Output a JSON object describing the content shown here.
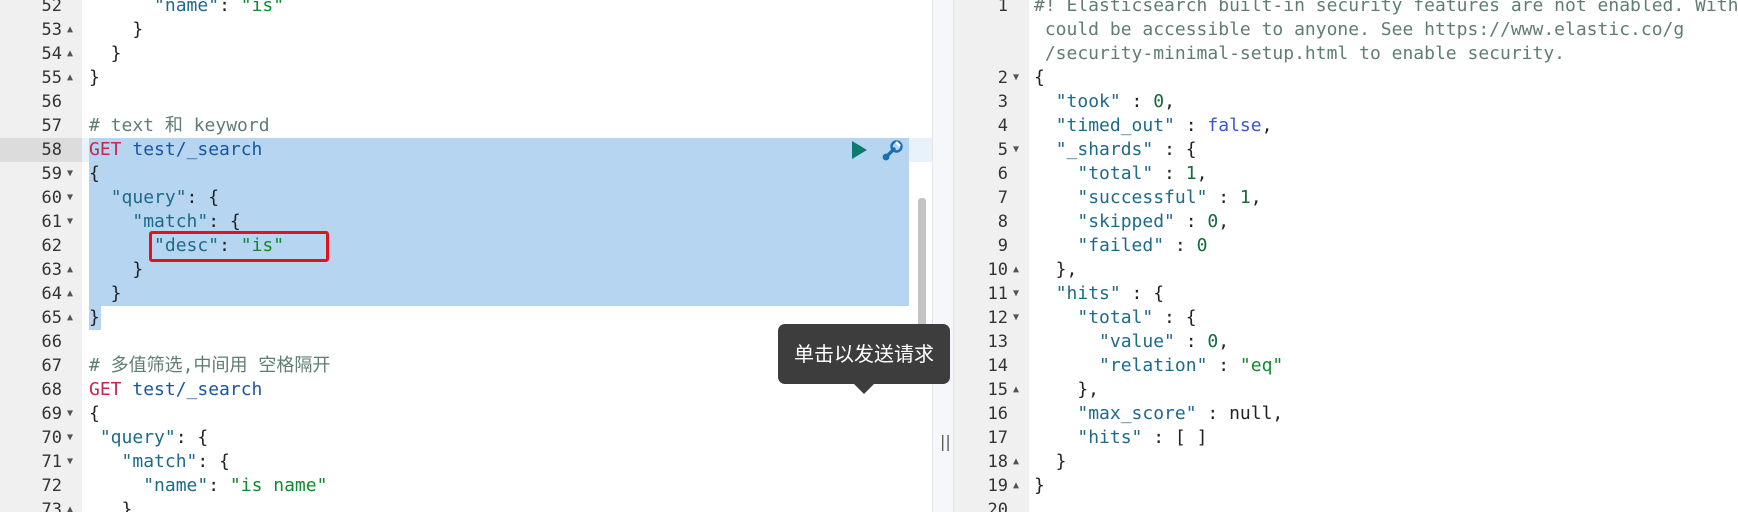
{
  "request_editor": {
    "lines": [
      {
        "no": "52",
        "fold": "",
        "parts": [
          {
            "t": "      ",
            "c": ""
          },
          {
            "t": "\"name\"",
            "c": "key"
          },
          {
            "t": ": ",
            "c": "dark"
          },
          {
            "t": "\"is\"",
            "c": "str"
          }
        ]
      },
      {
        "no": "53",
        "fold": "▲",
        "parts": [
          {
            "t": "    }",
            "c": "dark"
          }
        ]
      },
      {
        "no": "54",
        "fold": "▲",
        "parts": [
          {
            "t": "  }",
            "c": "dark"
          }
        ]
      },
      {
        "no": "55",
        "fold": "▲",
        "parts": [
          {
            "t": "}",
            "c": "dark"
          }
        ]
      },
      {
        "no": "56",
        "fold": "",
        "parts": []
      },
      {
        "no": "57",
        "fold": "",
        "parts": [
          {
            "t": "# text 和 keyword",
            "c": "cm"
          }
        ]
      },
      {
        "no": "58",
        "fold": "",
        "parts": [
          {
            "t": "GET",
            "c": "k"
          },
          {
            "t": " test/_search",
            "c": "p"
          }
        ]
      },
      {
        "no": "59",
        "fold": "▼",
        "parts": [
          {
            "t": "{",
            "c": "dark"
          }
        ]
      },
      {
        "no": "60",
        "fold": "▼",
        "parts": [
          {
            "t": "  ",
            "c": ""
          },
          {
            "t": "\"query\"",
            "c": "key"
          },
          {
            "t": ": {",
            "c": "dark"
          }
        ]
      },
      {
        "no": "61",
        "fold": "▼",
        "parts": [
          {
            "t": "    ",
            "c": ""
          },
          {
            "t": "\"match\"",
            "c": "key"
          },
          {
            "t": ": {",
            "c": "dark"
          }
        ]
      },
      {
        "no": "62",
        "fold": "",
        "parts": [
          {
            "t": "      ",
            "c": ""
          },
          {
            "t": "\"desc\"",
            "c": "key"
          },
          {
            "t": ": ",
            "c": "dark"
          },
          {
            "t": "\"is\"",
            "c": "str"
          }
        ]
      },
      {
        "no": "63",
        "fold": "▲",
        "parts": [
          {
            "t": "    }",
            "c": "dark"
          }
        ]
      },
      {
        "no": "64",
        "fold": "▲",
        "parts": [
          {
            "t": "  }",
            "c": "dark"
          }
        ]
      },
      {
        "no": "65",
        "fold": "▲",
        "parts": [
          {
            "t": "}",
            "c": "dark"
          }
        ]
      },
      {
        "no": "66",
        "fold": "",
        "parts": []
      },
      {
        "no": "67",
        "fold": "",
        "parts": [
          {
            "t": "# 多值筛选,中间用 空格隔开",
            "c": "cm"
          }
        ]
      },
      {
        "no": "68",
        "fold": "",
        "parts": [
          {
            "t": "GET",
            "c": "k"
          },
          {
            "t": " test/_search",
            "c": "p"
          }
        ]
      },
      {
        "no": "69",
        "fold": "▼",
        "parts": [
          {
            "t": "{",
            "c": "dark"
          }
        ]
      },
      {
        "no": "70",
        "fold": "▼",
        "parts": [
          {
            "t": " ",
            "c": ""
          },
          {
            "t": "\"query\"",
            "c": "key"
          },
          {
            "t": ": {",
            "c": "dark"
          }
        ]
      },
      {
        "no": "71",
        "fold": "▼",
        "parts": [
          {
            "t": "   ",
            "c": ""
          },
          {
            "t": "\"match\"",
            "c": "key"
          },
          {
            "t": ": {",
            "c": "dark"
          }
        ]
      },
      {
        "no": "72",
        "fold": "",
        "parts": [
          {
            "t": "     ",
            "c": ""
          },
          {
            "t": "\"name\"",
            "c": "key"
          },
          {
            "t": ": ",
            "c": "dark"
          },
          {
            "t": "\"is name\"",
            "c": "str"
          }
        ]
      },
      {
        "no": "73",
        "fold": "▲",
        "parts": [
          {
            "t": "   }",
            "c": "dark"
          }
        ]
      }
    ]
  },
  "tooltip": {
    "text": "单击以发送请求"
  },
  "response_viewer": {
    "lines": [
      {
        "no": "1",
        "fold": "",
        "parts": [
          {
            "t": "#! Elasticsearch built-in security features are not enabled. Without authentication, your cluster",
            "c": "cm"
          }
        ]
      },
      {
        "no": "",
        "fold": "",
        "parts": [
          {
            "t": " could be accessible to anyone. See https://www.elastic.co/g",
            "c": "cm"
          }
        ]
      },
      {
        "no": "",
        "fold": "",
        "parts": [
          {
            "t": " /security-minimal-setup.html to enable security.",
            "c": "cm"
          }
        ]
      },
      {
        "no": "2",
        "fold": "▼",
        "parts": [
          {
            "t": "{",
            "c": "dark"
          }
        ]
      },
      {
        "no": "3",
        "fold": "",
        "parts": [
          {
            "t": "  ",
            "c": ""
          },
          {
            "t": "\"took\"",
            "c": "key"
          },
          {
            "t": " : ",
            "c": "dark"
          },
          {
            "t": "0",
            "c": "num"
          },
          {
            "t": ",",
            "c": "dark"
          }
        ]
      },
      {
        "no": "4",
        "fold": "",
        "parts": [
          {
            "t": "  ",
            "c": ""
          },
          {
            "t": "\"timed_out\"",
            "c": "key"
          },
          {
            "t": " : ",
            "c": "dark"
          },
          {
            "t": "false",
            "c": "kw"
          },
          {
            "t": ",",
            "c": "dark"
          }
        ]
      },
      {
        "no": "5",
        "fold": "▼",
        "parts": [
          {
            "t": "  ",
            "c": ""
          },
          {
            "t": "\"_shards\"",
            "c": "key"
          },
          {
            "t": " : {",
            "c": "dark"
          }
        ]
      },
      {
        "no": "6",
        "fold": "",
        "parts": [
          {
            "t": "    ",
            "c": ""
          },
          {
            "t": "\"total\"",
            "c": "key"
          },
          {
            "t": " : ",
            "c": "dark"
          },
          {
            "t": "1",
            "c": "num"
          },
          {
            "t": ",",
            "c": "dark"
          }
        ]
      },
      {
        "no": "7",
        "fold": "",
        "parts": [
          {
            "t": "    ",
            "c": ""
          },
          {
            "t": "\"successful\"",
            "c": "key"
          },
          {
            "t": " : ",
            "c": "dark"
          },
          {
            "t": "1",
            "c": "num"
          },
          {
            "t": ",",
            "c": "dark"
          }
        ]
      },
      {
        "no": "8",
        "fold": "",
        "parts": [
          {
            "t": "    ",
            "c": ""
          },
          {
            "t": "\"skipped\"",
            "c": "key"
          },
          {
            "t": " : ",
            "c": "dark"
          },
          {
            "t": "0",
            "c": "num"
          },
          {
            "t": ",",
            "c": "dark"
          }
        ]
      },
      {
        "no": "9",
        "fold": "",
        "parts": [
          {
            "t": "    ",
            "c": ""
          },
          {
            "t": "\"failed\"",
            "c": "key"
          },
          {
            "t": " : ",
            "c": "dark"
          },
          {
            "t": "0",
            "c": "num"
          }
        ]
      },
      {
        "no": "10",
        "fold": "▲",
        "parts": [
          {
            "t": "  },",
            "c": "dark"
          }
        ]
      },
      {
        "no": "11",
        "fold": "▼",
        "parts": [
          {
            "t": "  ",
            "c": ""
          },
          {
            "t": "\"hits\"",
            "c": "key"
          },
          {
            "t": " : {",
            "c": "dark"
          }
        ]
      },
      {
        "no": "12",
        "fold": "▼",
        "parts": [
          {
            "t": "    ",
            "c": ""
          },
          {
            "t": "\"total\"",
            "c": "key"
          },
          {
            "t": " : {",
            "c": "dark"
          }
        ]
      },
      {
        "no": "13",
        "fold": "",
        "parts": [
          {
            "t": "      ",
            "c": ""
          },
          {
            "t": "\"value\"",
            "c": "key"
          },
          {
            "t": " : ",
            "c": "dark"
          },
          {
            "t": "0",
            "c": "num"
          },
          {
            "t": ",",
            "c": "dark"
          }
        ]
      },
      {
        "no": "14",
        "fold": "",
        "parts": [
          {
            "t": "      ",
            "c": ""
          },
          {
            "t": "\"relation\"",
            "c": "key"
          },
          {
            "t": " : ",
            "c": "dark"
          },
          {
            "t": "\"eq\"",
            "c": "str"
          }
        ]
      },
      {
        "no": "15",
        "fold": "▲",
        "parts": [
          {
            "t": "    },",
            "c": "dark"
          }
        ]
      },
      {
        "no": "16",
        "fold": "",
        "parts": [
          {
            "t": "    ",
            "c": ""
          },
          {
            "t": "\"max_score\"",
            "c": "key"
          },
          {
            "t": " : null,",
            "c": "dark"
          }
        ]
      },
      {
        "no": "17",
        "fold": "",
        "parts": [
          {
            "t": "    ",
            "c": ""
          },
          {
            "t": "\"hits\"",
            "c": "key"
          },
          {
            "t": " : [ ]",
            "c": "dark"
          }
        ]
      },
      {
        "no": "18",
        "fold": "▲",
        "parts": [
          {
            "t": "  }",
            "c": "dark"
          }
        ]
      },
      {
        "no": "19",
        "fold": "▲",
        "parts": [
          {
            "t": "}",
            "c": "dark"
          }
        ]
      },
      {
        "no": "20",
        "fold": "",
        "parts": []
      }
    ]
  },
  "icons": {
    "play": "play-icon",
    "wrench": "wrench-icon",
    "error": "error-icon",
    "resize": "resize-handle-icon"
  },
  "colors": {
    "selection": "#b5d5f0",
    "highlight_box": "#e5121b",
    "play": "#0d7a6e"
  }
}
